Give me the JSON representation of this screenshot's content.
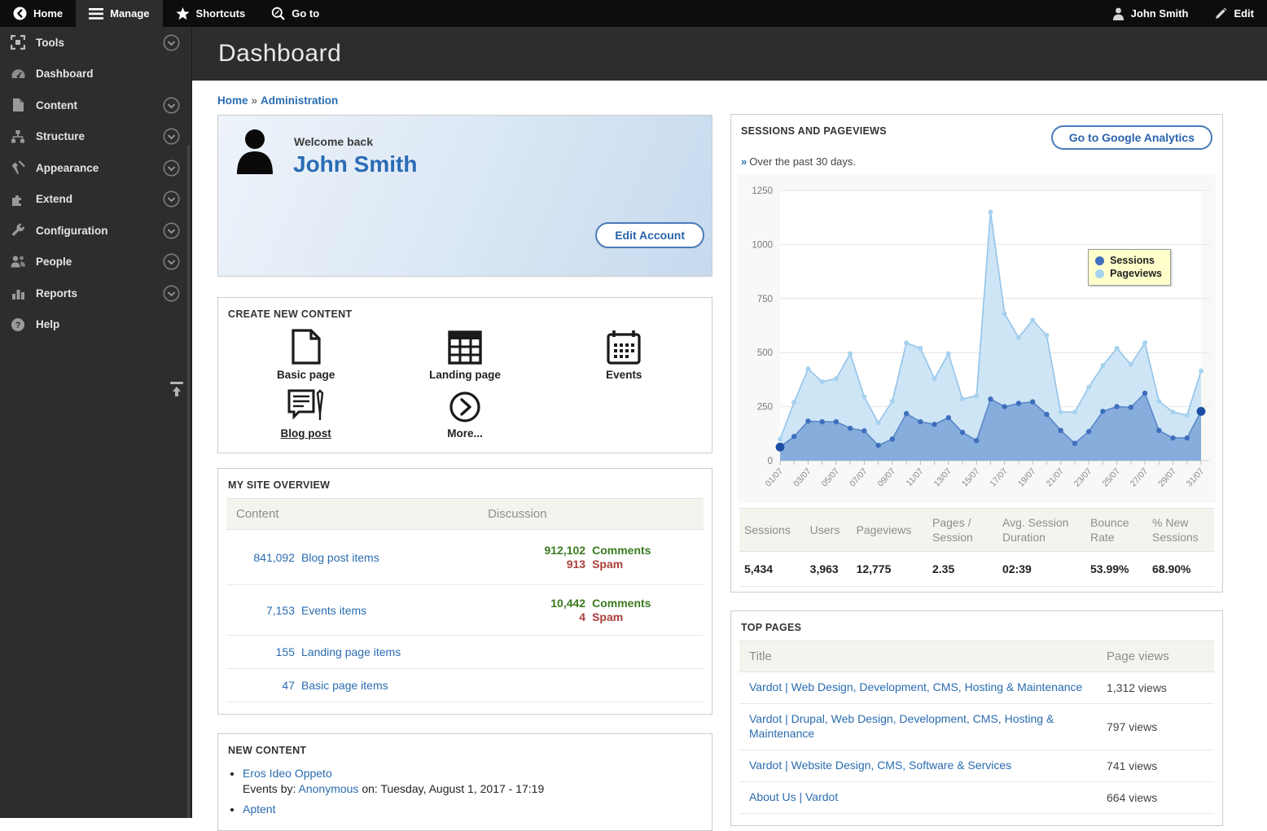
{
  "toolbar": {
    "home": "Home",
    "manage": "Manage",
    "shortcuts": "Shortcuts",
    "goto": "Go to",
    "user": "John Smith",
    "edit": "Edit"
  },
  "sidebar": {
    "items": [
      {
        "label": "Tools"
      },
      {
        "label": "Dashboard"
      },
      {
        "label": "Content"
      },
      {
        "label": "Structure"
      },
      {
        "label": "Appearance"
      },
      {
        "label": "Extend"
      },
      {
        "label": "Configuration"
      },
      {
        "label": "People"
      },
      {
        "label": "Reports"
      },
      {
        "label": "Help"
      }
    ]
  },
  "header": {
    "page_title": "Dashboard"
  },
  "breadcrumb": {
    "home": "Home",
    "separator": "»",
    "current": "Administration"
  },
  "welcome": {
    "greeting": "Welcome back",
    "name": "John Smith",
    "edit_button": "Edit Account"
  },
  "create_content": {
    "title": "CREATE NEW CONTENT",
    "items": [
      {
        "label": "Basic page"
      },
      {
        "label": "Landing page"
      },
      {
        "label": "Events"
      },
      {
        "label": "Blog post"
      },
      {
        "label": "More..."
      }
    ]
  },
  "site_overview": {
    "title": "MY SITE OVERVIEW",
    "columns": [
      "Content",
      "Discussion"
    ],
    "rows": [
      {
        "count": "841,092",
        "label": "Blog post items",
        "comments": "912,102",
        "comments_label": "Comments",
        "spam": "913",
        "spam_label": "Spam"
      },
      {
        "count": "7,153",
        "label": "Events items",
        "comments": "10,442",
        "comments_label": "Comments",
        "spam": "4",
        "spam_label": "Spam"
      },
      {
        "count": "155",
        "label": "Landing page items"
      },
      {
        "count": "47",
        "label": "Basic page items"
      }
    ]
  },
  "new_content": {
    "title": "NEW CONTENT",
    "items": [
      {
        "title": "Eros Ideo Oppeto",
        "meta_prefix": "Events by:",
        "author": "Anonymous",
        "meta_middle": "on:",
        "date": "Tuesday, August 1, 2017 - 17:19"
      },
      {
        "title": "Aptent"
      }
    ]
  },
  "analytics": {
    "title": "SESSIONS AND PAGEVIEWS",
    "subtitle_marker": "»",
    "subtitle": "Over the past 30 days.",
    "button": "Go to Google Analytics",
    "stats": {
      "headers": [
        "Sessions",
        "Users",
        "Pageviews",
        "Pages / Session",
        "Avg. Session Duration",
        "Bounce Rate",
        "% New Sessions"
      ],
      "values": [
        "5,434",
        "3,963",
        "12,775",
        "2.35",
        "02:39",
        "53.99%",
        "68.90%"
      ]
    }
  },
  "chart_data": {
    "type": "area",
    "title": "Sessions and Pageviews over the past 30 days",
    "x": [
      "01/07",
      "02/07",
      "03/07",
      "04/07",
      "05/07",
      "06/07",
      "07/07",
      "08/07",
      "09/07",
      "10/07",
      "11/07",
      "12/07",
      "13/07",
      "14/07",
      "15/07",
      "16/07",
      "17/07",
      "18/07",
      "19/07",
      "20/07",
      "21/07",
      "22/07",
      "23/07",
      "24/07",
      "25/07",
      "26/07",
      "27/07",
      "28/07",
      "29/07",
      "30/07",
      "31/07"
    ],
    "x_label_step": 2,
    "ylim": [
      0,
      1250
    ],
    "yticks": [
      0,
      250,
      500,
      750,
      1000,
      1250
    ],
    "grid": true,
    "legend_position": "top-right",
    "series": [
      {
        "name": "Sessions",
        "line": "#5b87c8",
        "fill": "#7fa6d9",
        "marker": "#3e6fbe",
        "endpoint": "#1c4fa3",
        "values": [
          63,
          112,
          183,
          180,
          180,
          150,
          138,
          71,
          100,
          218,
          180,
          168,
          199,
          131,
          93,
          285,
          250,
          265,
          272,
          214,
          140,
          80,
          135,
          228,
          250,
          247,
          312,
          140,
          105,
          105,
          228
        ]
      },
      {
        "name": "Pageviews",
        "line": "#93c4e9",
        "fill": "#cbe4f6",
        "marker": "#a6d2ef",
        "values": [
          100,
          270,
          425,
          365,
          380,
          495,
          295,
          175,
          275,
          545,
          520,
          380,
          495,
          285,
          300,
          1150,
          680,
          570,
          650,
          580,
          225,
          225,
          340,
          440,
          520,
          445,
          545,
          275,
          225,
          210,
          415
        ]
      }
    ]
  },
  "top_pages": {
    "title": "TOP PAGES",
    "columns": [
      "Title",
      "Page views"
    ],
    "rows": [
      {
        "title": "Vardot | Web Design, Development, CMS, Hosting & Maintenance",
        "views": "1,312 views"
      },
      {
        "title": "Vardot | Drupal, Web Design, Development, CMS, Hosting & Maintenance",
        "views": "797 views"
      },
      {
        "title": "Vardot | Website Design, CMS, Software & Services",
        "views": "741 views"
      },
      {
        "title": "About Us | Vardot",
        "views": "664 views"
      }
    ]
  },
  "colors": {
    "accent_link": "#2a6cb0",
    "comments_green": "#3a7a1e",
    "spam_red": "#aa403c",
    "sessions_blue": "#3e6fbe",
    "pageviews_blue": "#a6d2ef",
    "legend_bg": "#ffffcc",
    "toolbar_bg": "#0d0d0d",
    "sidebar_bg": "#2d2d2d"
  }
}
